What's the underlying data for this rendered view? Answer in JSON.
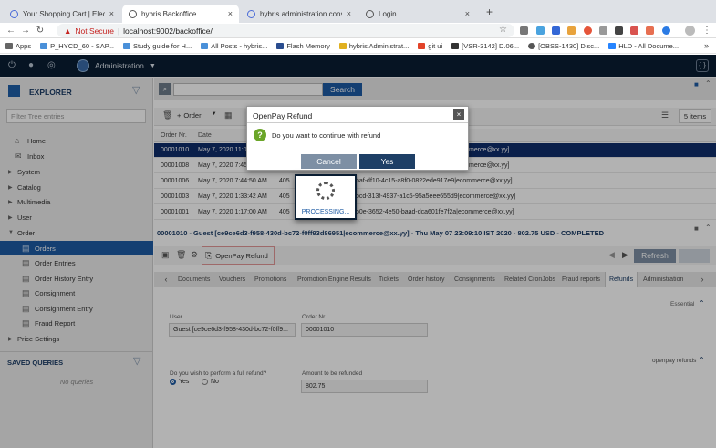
{
  "browser": {
    "tabs": [
      {
        "title": "Your Shopping Cart | Electroni",
        "close": "×"
      },
      {
        "title": "hybris Backoffice",
        "close": "×"
      },
      {
        "title": "hybris administration console",
        "close": "×"
      },
      {
        "title": "Login",
        "close": "×"
      }
    ],
    "new_tab": "+",
    "security": "Not Secure",
    "url": "localhost:9002/backoffice/",
    "bookmarks": [
      "Apps",
      "P_HYCD_60 - SAP...",
      "Study guide for H...",
      "All Posts - hybris...",
      "Flash Memory",
      "hybris Administrat...",
      "git ui",
      "[VSR-3142] D.06...",
      "[OBSS-1430] Disc...",
      "HLD - All Docume..."
    ],
    "bookmarks_more": "»"
  },
  "header": {
    "perspective": "Administration"
  },
  "explorer": {
    "title": "EXPLORER",
    "filter_placeholder": "Filter Tree entries",
    "tree": [
      {
        "label": "Home",
        "icon": "home-icon",
        "caret": ""
      },
      {
        "label": "Inbox",
        "icon": "inbox-icon",
        "caret": ""
      },
      {
        "label": "System",
        "icon": "",
        "caret": "▶"
      },
      {
        "label": "Catalog",
        "icon": "",
        "caret": "▶"
      },
      {
        "label": "Multimedia",
        "icon": "",
        "caret": "▶"
      },
      {
        "label": "User",
        "icon": "",
        "caret": "▶"
      },
      {
        "label": "Order",
        "icon": "",
        "caret": "▼"
      },
      {
        "label": "Orders",
        "icon": "document-icon",
        "caret": ""
      },
      {
        "label": "Order Entries",
        "icon": "document-icon",
        "caret": ""
      },
      {
        "label": "Order History Entry",
        "icon": "document-icon",
        "caret": ""
      },
      {
        "label": "Consignment",
        "icon": "document-icon",
        "caret": ""
      },
      {
        "label": "Consignment Entry",
        "icon": "document-icon",
        "caret": ""
      },
      {
        "label": "Fraud Report",
        "icon": "document-icon",
        "caret": ""
      },
      {
        "label": "Price Settings",
        "icon": "",
        "caret": "▶"
      }
    ],
    "saved_queries_title": "SAVED QUERIES",
    "no_queries": "No queries"
  },
  "search": {
    "button": "Search"
  },
  "list": {
    "create_label": "Order",
    "items_count": "5 items",
    "columns": [
      "Order Nr.",
      "Date"
    ],
    "rows": [
      {
        "order": "00001010",
        "date": "May 7, 2020 11:0",
        "email": "merce@xx.yy]"
      },
      {
        "order": "00001008",
        "date": "May 7, 2020 7:45",
        "email": "merce@xx.yy]"
      },
      {
        "order": "00001006",
        "date": "May 7, 2020 7:44:50 AM",
        "prefix": "405",
        "email": "baf-df10-4c15-a8f0-0822ede917e9|ecommerce@xx.yy]"
      },
      {
        "order": "00001003",
        "date": "May 7, 2020 1:33:42 AM",
        "prefix": "405",
        "email": "ocd-313f-4937-a1c5-95a5eee655d9|ecommerce@xx.yy]"
      },
      {
        "order": "00001001",
        "date": "May 7, 2020 1:17:00 AM",
        "prefix": "405",
        "email": "o0e-3652-4e50-baad-dca601fe7f2a|ecommerce@xx.yy]"
      }
    ]
  },
  "editor": {
    "header": "00001010 - Guest [ce9ce6d3-f958-430d-bc72-f0ff93d86951|ecommerce@xx.yy] - Thu May 07 23:09:10 IST 2020 - 802.75 USD - COMPLETED",
    "refund_action": "OpenPay Refund",
    "refresh": "Refresh",
    "tabs": [
      "Documents",
      "Vouchers",
      "Promotions",
      "Promotion Engine Results",
      "Tickets",
      "Order history",
      "Consignments",
      "Related CronJobs",
      "Fraud reports",
      "Refunds",
      "Administration"
    ],
    "active_tab": "Refunds",
    "section_essential": "Essential",
    "user_label": "User",
    "user_value": "Guest [ce9ce6d3-f958-430d-bc72-f0ff9...",
    "order_label": "Order Nr.",
    "order_value": "00001010",
    "section_refunds": "openpay refunds",
    "full_refund_label": "Do you wish to perform a full refund?",
    "radio_yes": "Yes",
    "radio_no": "No",
    "full_refund_selected": "Yes",
    "amount_label": "Amount to be refunded",
    "amount_value": "802.75"
  },
  "dialog": {
    "title": "OpenPay Refund",
    "close": "×",
    "message": "Do you want to continue with refund",
    "cancel": "Cancel",
    "yes": "Yes"
  },
  "processing": {
    "text": "PROCESSING..."
  },
  "colors": {
    "brand_blue": "#1e5ba4",
    "header_dark": "#0a1e33",
    "selected_row": "#0f2d6b",
    "dialog_yes": "#1e3f66",
    "dialog_cancel": "#7d8fa4"
  }
}
